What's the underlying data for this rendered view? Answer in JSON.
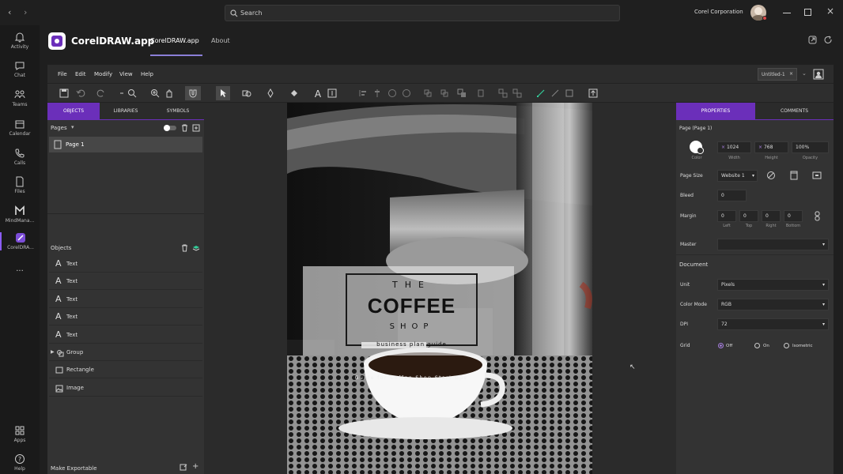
{
  "titlebar": {
    "search_placeholder": "Search",
    "org": "Corel Corporation"
  },
  "rail": [
    {
      "label": "Activity",
      "icon": "bell-icon"
    },
    {
      "label": "Chat",
      "icon": "chat-icon"
    },
    {
      "label": "Teams",
      "icon": "teams-icon"
    },
    {
      "label": "Calendar",
      "icon": "calendar-icon"
    },
    {
      "label": "Calls",
      "icon": "phone-icon"
    },
    {
      "label": "Files",
      "icon": "file-icon"
    },
    {
      "label": "MindMana...",
      "icon": "mindmanager-icon"
    },
    {
      "label": "CorelDRA...",
      "icon": "coreldraw-icon"
    },
    {
      "label": "Apps",
      "icon": "apps-icon"
    },
    {
      "label": "Help",
      "icon": "help-icon"
    }
  ],
  "apphead": {
    "app_name": "CorelDRAW.app",
    "tab_active": "CorelDRAW.app",
    "tab_about": "About"
  },
  "menu": [
    "File",
    "Edit",
    "Modify",
    "View",
    "Help"
  ],
  "doc_tab": {
    "label": "Untitled-1"
  },
  "left": {
    "tabs": [
      "OBJECTS",
      "LIBRARIES",
      "SYMBOLS"
    ],
    "pages_label": "Pages",
    "page1": "Page 1",
    "objects_label": "Objects",
    "objects": [
      {
        "label": "Text",
        "icon": "text-icon"
      },
      {
        "label": "Text",
        "icon": "text-icon"
      },
      {
        "label": "Text",
        "icon": "text-icon"
      },
      {
        "label": "Text",
        "icon": "text-icon"
      },
      {
        "label": "Text",
        "icon": "text-icon"
      },
      {
        "label": "Group",
        "icon": "group-icon"
      },
      {
        "label": "Rectangle",
        "icon": "rectangle-icon"
      },
      {
        "label": "Image",
        "icon": "image-icon"
      }
    ],
    "footer": "Make Exportable"
  },
  "canvas": {
    "the": "THE",
    "coffee": "COFFEE",
    "shop": "SHOP",
    "tagline": "business plan guide",
    "subtitle": "Guide for Coffee Shop Start Ups"
  },
  "right": {
    "tabs": [
      "PROPERTIES",
      "COMMENTS"
    ],
    "page_title": "Page (Page 1)",
    "color_label": "Color",
    "width_val": "1024",
    "width_label": "Width",
    "height_val": "768",
    "height_label": "Height",
    "opacity_val": "100%",
    "opacity_label": "Opacity",
    "pagesize_label": "Page Size",
    "pagesize_val": "Website 1",
    "bleed_label": "Bleed",
    "bleed_val": "0",
    "margin_label": "Margin",
    "margins": [
      {
        "val": "0",
        "label": "Left"
      },
      {
        "val": "0",
        "label": "Top"
      },
      {
        "val": "0",
        "label": "Right"
      },
      {
        "val": "0",
        "label": "Bottom"
      }
    ],
    "master_label": "Master",
    "document_label": "Document",
    "unit_label": "Unit",
    "unit_val": "Pixels",
    "colormode_label": "Color Mode",
    "colormode_val": "RGB",
    "dpi_label": "DPI",
    "dpi_val": "72",
    "grid_label": "Grid",
    "grid_options": [
      "Off",
      "On",
      "Isometric"
    ]
  },
  "colors": {
    "accent": "#6b2fba",
    "accent_light": "#8b5cf6"
  }
}
